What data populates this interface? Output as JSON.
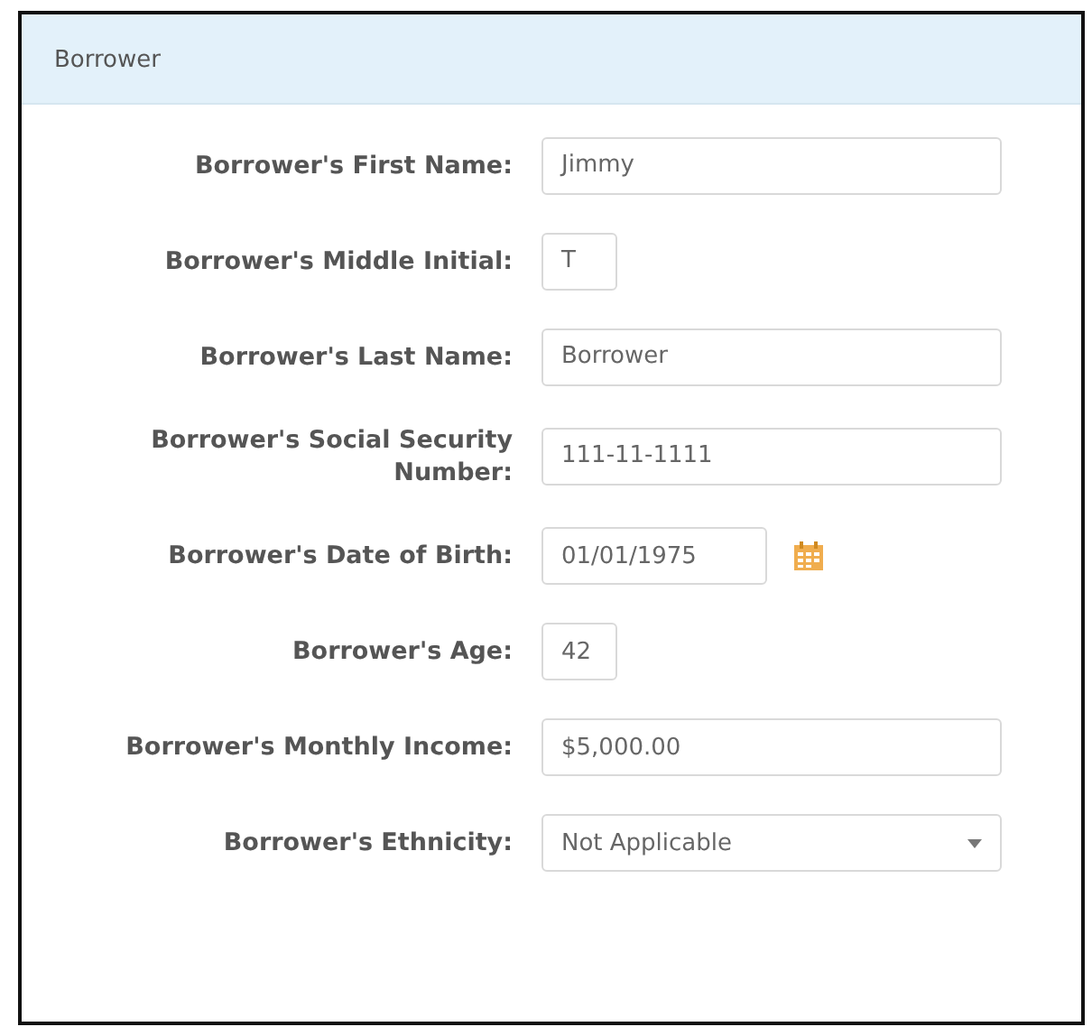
{
  "panel": {
    "title": "Borrower"
  },
  "fields": [
    {
      "label": "Borrower's First Name:",
      "kind": "text",
      "value": "Jimmy"
    },
    {
      "label": "Borrower's Middle Initial:",
      "kind": "short",
      "value": "T"
    },
    {
      "label": "Borrower's Last Name:",
      "kind": "text",
      "value": "Borrower"
    },
    {
      "label": "Borrower's Social Security Number:",
      "kind": "text",
      "value": "111-11-1111"
    },
    {
      "label": "Borrower's Date of Birth:",
      "kind": "date",
      "value": "01/01/1975"
    },
    {
      "label": "Borrower's Age:",
      "kind": "short",
      "value": "42"
    },
    {
      "label": "Borrower's Monthly Income:",
      "kind": "text",
      "value": "$5,000.00"
    },
    {
      "label": "Borrower's Ethnicity:",
      "kind": "select",
      "value": "Not Applicable"
    }
  ]
}
